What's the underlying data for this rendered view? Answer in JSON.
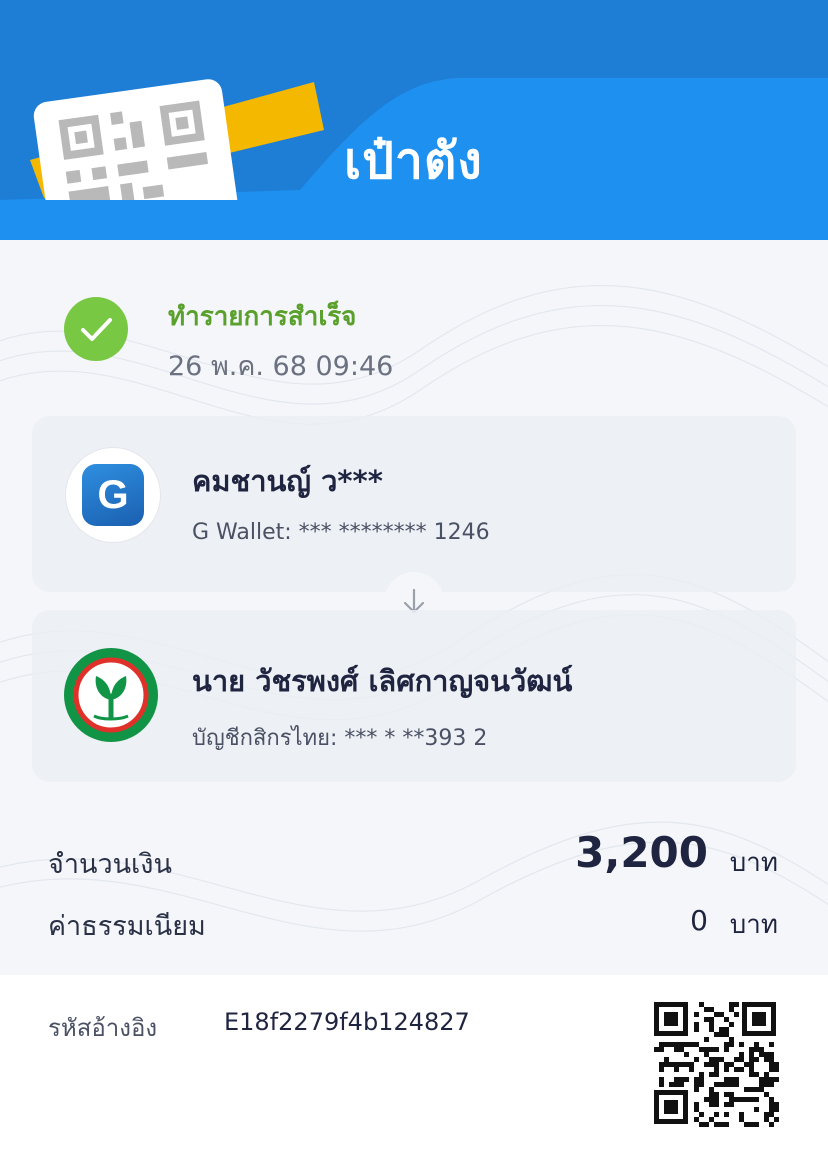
{
  "header": {
    "title": "เป๋าตัง",
    "logo_icon": "qr-card-icon",
    "colors": {
      "primary": "#1e7ed6",
      "accent": "#f5b800"
    }
  },
  "status": {
    "text": "ทำรายการสำเร็จ",
    "datetime": "26 พ.ค. 68 09:46",
    "icon": "check-circle-icon",
    "color": "#79c843"
  },
  "from": {
    "name": "คมชานญ์ ว***",
    "account": "G Wallet: *** ******** 1246",
    "logo": "g-wallet-icon",
    "logo_letter": "G"
  },
  "to": {
    "name": "นาย วัชรพงศ์ เลิศกาญจนวัฒน์",
    "account": "บัญชีกสิกรไทย: *** * **393 2",
    "logo": "kasikorn-bank-icon"
  },
  "amount": {
    "label": "จำนวนเงิน",
    "value": "3,200",
    "unit": "บาท"
  },
  "fee": {
    "label": "ค่าธรรมเนียม",
    "value": "0",
    "unit": "บาท"
  },
  "reference": {
    "label": "รหัสอ้างอิง",
    "value": "E18f2279f4b124827"
  }
}
